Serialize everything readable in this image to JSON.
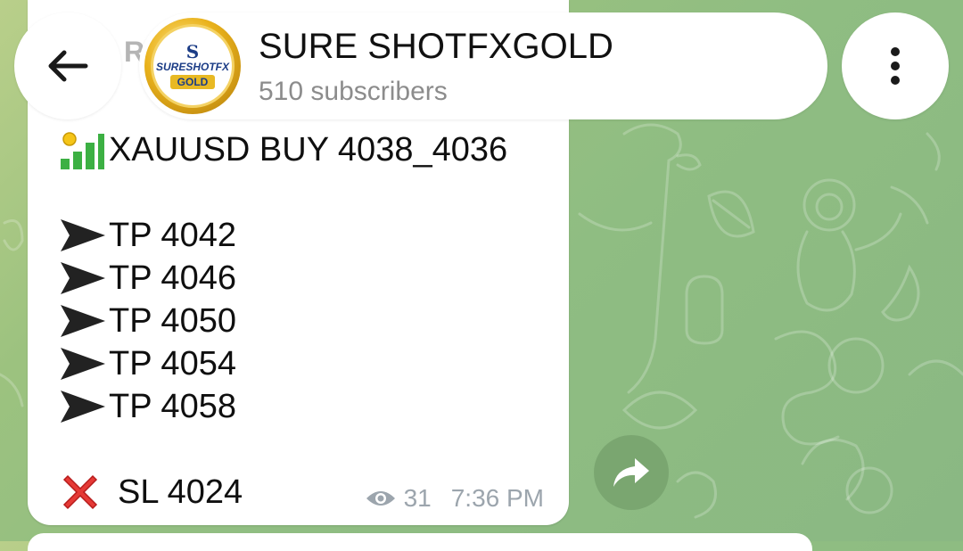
{
  "header": {
    "channel_title": "SURE SHOTFXGOLD",
    "subscribers": "510 subscribers",
    "avatar_brand": "SURESHOTFX",
    "avatar_gold": "GOLD",
    "avatar_symbol": "S",
    "back_icon": "arrow-left-icon",
    "more_icon": "more-vert-icon"
  },
  "message": {
    "faded_top_text": "R OLD",
    "signal": "XAUUSD BUY 4038_4036",
    "take_profits": [
      "TP 4042",
      "TP 4046",
      "TP 4050",
      "TP 4054",
      "TP 4058"
    ],
    "stop_loss": "SL 4024",
    "views": "31",
    "time": "7:36 PM"
  },
  "colors": {
    "wallpaper": "#8fbd82",
    "bubble": "#ffffff",
    "meta_text": "#9ca5ad",
    "arrow": "#222222",
    "x_mark": "#e53935"
  }
}
